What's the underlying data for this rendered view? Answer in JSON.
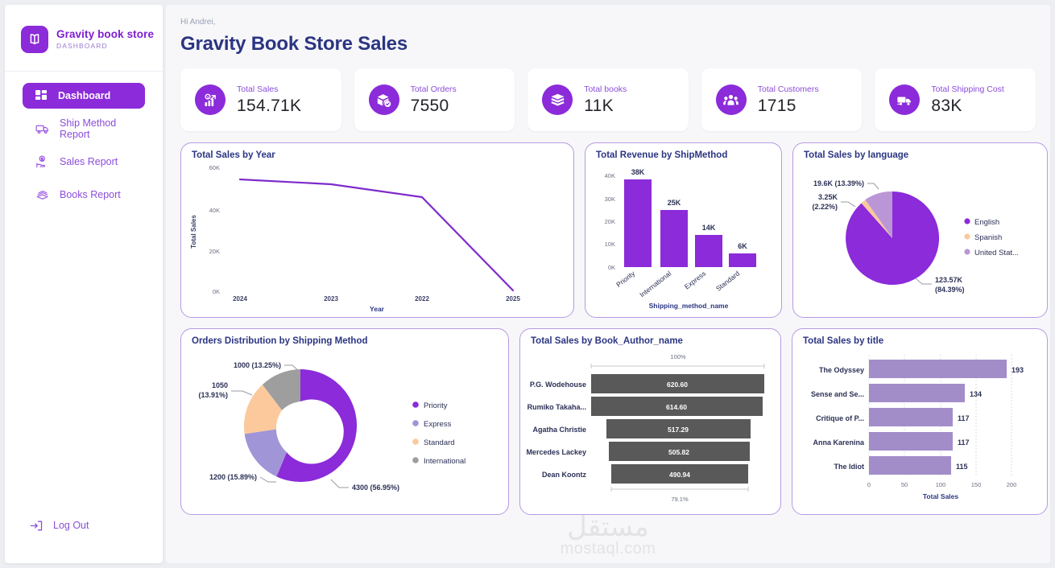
{
  "sidebar": {
    "brand_name": "Gravity book store",
    "brand_sub": "DASHBOARD",
    "items": [
      {
        "label": "Dashboard",
        "icon": "grid-icon",
        "active": true
      },
      {
        "label": "Ship Method Report",
        "icon": "truck-icon",
        "active": false
      },
      {
        "label": "Sales Report",
        "icon": "money-hand-icon",
        "active": false
      },
      {
        "label": "Books Report",
        "icon": "books-icon",
        "active": false
      }
    ],
    "logout_label": "Log Out",
    "logout_icon": "logout-icon"
  },
  "header": {
    "greeting": "Hi Andrei,",
    "title": "Gravity Book Store Sales"
  },
  "kpis": [
    {
      "label": "Total Sales",
      "value": "154.71K",
      "icon": "sales-chart-icon"
    },
    {
      "label": "Total Orders",
      "value": "7550",
      "icon": "package-check-icon"
    },
    {
      "label": "Total books",
      "value": "11K",
      "icon": "book-stack-icon"
    },
    {
      "label": "Total Customers",
      "value": "1715",
      "icon": "people-icon"
    },
    {
      "label": "Total Shipping Cost",
      "value": "83K",
      "icon": "delivery-truck-icon"
    }
  ],
  "colors": {
    "brand_purple": "#8B2BD9",
    "line_purple": "#7E2BCC",
    "light_purple": "#a095d6",
    "lilac": "#b79ae2",
    "peach": "#fbc99c",
    "grey": "#9e9e9e",
    "dark_bar": "#595959",
    "title_navy": "#2b3582"
  },
  "chart_data": [
    {
      "id": "total-sales-by-year",
      "type": "line",
      "title": "Total Sales by Year",
      "xlabel": "Year",
      "ylabel": "Total Sales",
      "categories": [
        "2024",
        "2023",
        "2022",
        "2025"
      ],
      "values": [
        54000,
        52000,
        46000,
        1000
      ],
      "yticks": [
        "0K",
        "20K",
        "40K",
        "60K"
      ],
      "ylim": [
        0,
        60000
      ],
      "grid": false,
      "legend": "none"
    },
    {
      "id": "total-revenue-by-shipmethod",
      "type": "bar",
      "title": "Total Revenue by ShipMethod",
      "xlabel": "Shipping_method_name",
      "ylabel": "",
      "categories": [
        "Priority",
        "International",
        "Express",
        "Standard"
      ],
      "values": [
        38000,
        25000,
        14000,
        6000
      ],
      "data_labels": [
        "38K",
        "25K",
        "14K",
        "6K"
      ],
      "yticks": [
        "0K",
        "10K",
        "20K",
        "30K",
        "40K"
      ],
      "ylim": [
        0,
        42000
      ],
      "grid": false,
      "legend": "none"
    },
    {
      "id": "total-sales-by-language",
      "type": "pie",
      "title": "Total Sales by language",
      "labels": [
        "English",
        "Spanish",
        "United Stat..."
      ],
      "values": [
        123570,
        3250,
        19600
      ],
      "percents": [
        "84.39%",
        "2.22%",
        "13.39%"
      ],
      "data_labels": [
        "123.57K\n(84.39%)",
        "3.25K\n(2.22%)",
        "19.6K (13.39%)"
      ],
      "callout_english_l1": "123.57K",
      "callout_english_l2": "(84.39%)",
      "callout_spanish_l1": "3.25K",
      "callout_spanish_l2": "(2.22%)",
      "callout_us_l1": "19.6K (13.39%)",
      "slice_colors": [
        "#8B2BD9",
        "#fbc99c",
        "#bb96d7"
      ],
      "legend": "right"
    },
    {
      "id": "orders-distribution-by-shipping-method",
      "type": "pie",
      "title": "Orders Distribution by Shipping Method",
      "donut": true,
      "labels": [
        "Priority",
        "Express",
        "Standard",
        "International"
      ],
      "values": [
        4300,
        1200,
        1050,
        1000
      ],
      "percents": [
        "56.95%",
        "15.89%",
        "13.91%",
        "13.25%"
      ],
      "data_labels": [
        "4300 (56.95%)",
        "1200 (15.89%)",
        "1050\n(13.91%)",
        "1000 (13.25%)"
      ],
      "callout_priority": "4300 (56.95%)",
      "callout_express": "1200 (15.89%)",
      "callout_standard_l1": "1050",
      "callout_standard_l2": "(13.91%)",
      "callout_international": "1000 (13.25%)",
      "slice_colors": [
        "#8B2BD9",
        "#a095d6",
        "#fbc99c",
        "#9e9e9e"
      ],
      "legend": "right"
    },
    {
      "id": "total-sales-by-book-author-name",
      "type": "bar",
      "orientation": "horizontal",
      "title": "Total Sales by Book_Author_name",
      "top_axis_label": "100%",
      "bottom_axis_label": "79.1%",
      "categories": [
        "P.G. Wodehouse",
        "Rumiko Takaha...",
        "Agatha Christie",
        "Mercedes Lackey",
        "Dean Koontz"
      ],
      "values": [
        620.6,
        614.6,
        517.29,
        505.82,
        490.94
      ],
      "data_labels": [
        "620.60",
        "614.60",
        "517.29",
        "505.82",
        "490.94"
      ],
      "bar_color": "#595959",
      "legend": "none"
    },
    {
      "id": "total-sales-by-title",
      "type": "bar",
      "orientation": "horizontal",
      "title": "Total Sales by title",
      "xlabel": "Total Sales",
      "categories": [
        "The Odyssey",
        "Sense and Se...",
        "Critique of P...",
        "Anna Karenina",
        "The Idiot"
      ],
      "values": [
        193,
        134,
        117,
        117,
        115
      ],
      "data_labels": [
        "193",
        "134",
        "117",
        "117",
        "115"
      ],
      "xticks": [
        "0",
        "50",
        "100",
        "150",
        "200"
      ],
      "xlim": [
        0,
        215
      ],
      "bar_color": "#a28dc9",
      "grid": true,
      "legend": "none"
    }
  ],
  "watermark": {
    "arabic": "مستقل",
    "latin": "mostaql.com"
  }
}
